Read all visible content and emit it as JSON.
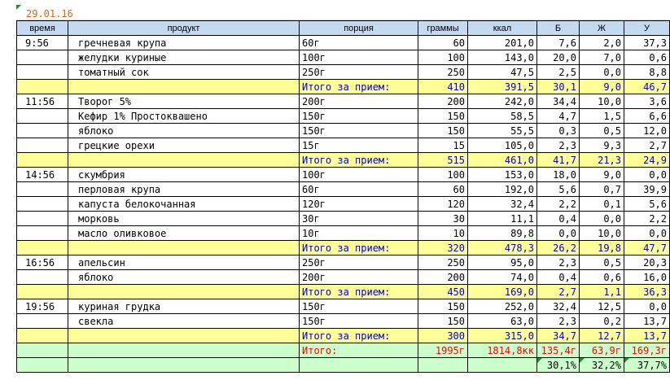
{
  "sheet": {
    "date": "29.01.16"
  },
  "columns": {
    "time": "время",
    "product": "продукт",
    "portion": "порция",
    "grams": "граммы",
    "kcal": "ккал",
    "b": "Б",
    "zh": "Ж",
    "u": "У"
  },
  "meals": [
    {
      "time": "9:56",
      "items": [
        {
          "product": "гречневая крупа",
          "portion": "60г",
          "grams": "60",
          "kcal": "201,0",
          "b": "7,6",
          "zh": "2,0",
          "u": "37,3"
        },
        {
          "product": "желудки куриные",
          "portion": "100г",
          "grams": "100",
          "kcal": "143,0",
          "b": "20,0",
          "zh": "7,0",
          "u": "0,6"
        },
        {
          "product": "томатный сок",
          "portion": "250г",
          "grams": "250",
          "kcal": "47,5",
          "b": "2,5",
          "zh": "0,0",
          "u": "8,8"
        }
      ],
      "subtotal": {
        "label": "Итого за прием:",
        "grams": "410",
        "kcal": "391,5",
        "b": "30,1",
        "zh": "9,0",
        "u": "46,7"
      }
    },
    {
      "time": "11:56",
      "items": [
        {
          "product": "Творог 5%",
          "portion": "200г",
          "grams": "200",
          "kcal": "242,0",
          "b": "34,4",
          "zh": "10,0",
          "u": "3,6"
        },
        {
          "product": "Кефир 1% Простоквашено",
          "portion": "150г",
          "grams": "150",
          "kcal": "58,5",
          "b": "4,7",
          "zh": "1,5",
          "u": "6,6"
        },
        {
          "product": "яблоко",
          "portion": "150г",
          "grams": "150",
          "kcal": "55,5",
          "b": "0,3",
          "zh": "0,5",
          "u": "12,0"
        },
        {
          "product": "грецкие орехи",
          "portion": "15г",
          "grams": "15",
          "kcal": "105,0",
          "b": "2,3",
          "zh": "9,3",
          "u": "2,7"
        }
      ],
      "subtotal": {
        "label": "Итого за прием:",
        "grams": "515",
        "kcal": "461,0",
        "b": "41,7",
        "zh": "21,3",
        "u": "24,9"
      }
    },
    {
      "time": "14:56",
      "items": [
        {
          "product": "скумбрия",
          "portion": "100г",
          "grams": "100",
          "kcal": "153,0",
          "b": "18,0",
          "zh": "9,0",
          "u": "0,0"
        },
        {
          "product": "перловая крупа",
          "portion": "60г",
          "grams": "60",
          "kcal": "192,0",
          "b": "5,6",
          "zh": "0,7",
          "u": "39,9"
        },
        {
          "product": "капуста белокочанная",
          "portion": "120г",
          "grams": "120",
          "kcal": "32,4",
          "b": "2,2",
          "zh": "0,1",
          "u": "5,6"
        },
        {
          "product": "морковь",
          "portion": "30г",
          "grams": "30",
          "kcal": "11,1",
          "b": "0,4",
          "zh": "0,0",
          "u": "2,2"
        },
        {
          "product": "масло оливковое",
          "portion": "10г",
          "grams": "10",
          "kcal": "89,8",
          "b": "0,0",
          "zh": "10,0",
          "u": "0,0"
        }
      ],
      "subtotal": {
        "label": "Итого за прием:",
        "grams": "320",
        "kcal": "478,3",
        "b": "26,2",
        "zh": "19,8",
        "u": "47,7"
      }
    },
    {
      "time": "16:56",
      "items": [
        {
          "product": "апельсин",
          "portion": "250г",
          "grams": "250",
          "kcal": "95,0",
          "b": "2,3",
          "zh": "0,5",
          "u": "20,3"
        },
        {
          "product": "яблоко",
          "portion": "200г",
          "grams": "200",
          "kcal": "74,0",
          "b": "0,4",
          "zh": "0,6",
          "u": "16,0"
        }
      ],
      "subtotal": {
        "label": "Итого за прием:",
        "grams": "450",
        "kcal": "169,0",
        "b": "2,7",
        "zh": "1,1",
        "u": "36,3"
      }
    },
    {
      "time": "19:56",
      "items": [
        {
          "product": "куриная грудка",
          "portion": "150г",
          "grams": "150",
          "kcal": "252,0",
          "b": "32,4",
          "zh": "12,5",
          "u": "0,0"
        },
        {
          "product": "свекла",
          "portion": "150г",
          "grams": "150",
          "kcal": "63,0",
          "b": "2,3",
          "zh": "0,2",
          "u": "13,7"
        }
      ],
      "subtotal": {
        "label": "Итого за прием:",
        "grams": "300",
        "kcal": "315,0",
        "b": "34,7",
        "zh": "12,7",
        "u": "13,7"
      }
    }
  ],
  "total": {
    "label": "Итого:",
    "grams": "1995г",
    "kcal": "1814,8кк",
    "b": "135,4г",
    "zh": "63,9г",
    "u": "169,3г"
  },
  "percent": {
    "b": "30,1%",
    "zh": "32,2%",
    "u": "37,7%"
  },
  "colors": {
    "header_bg": "#c5d9f1",
    "subtotal_bg": "#ffff99",
    "subtotal_text": "#0000cc",
    "total_bg": "#ccffcc",
    "total_text": "#ff0000",
    "date_text": "#d9661a"
  }
}
